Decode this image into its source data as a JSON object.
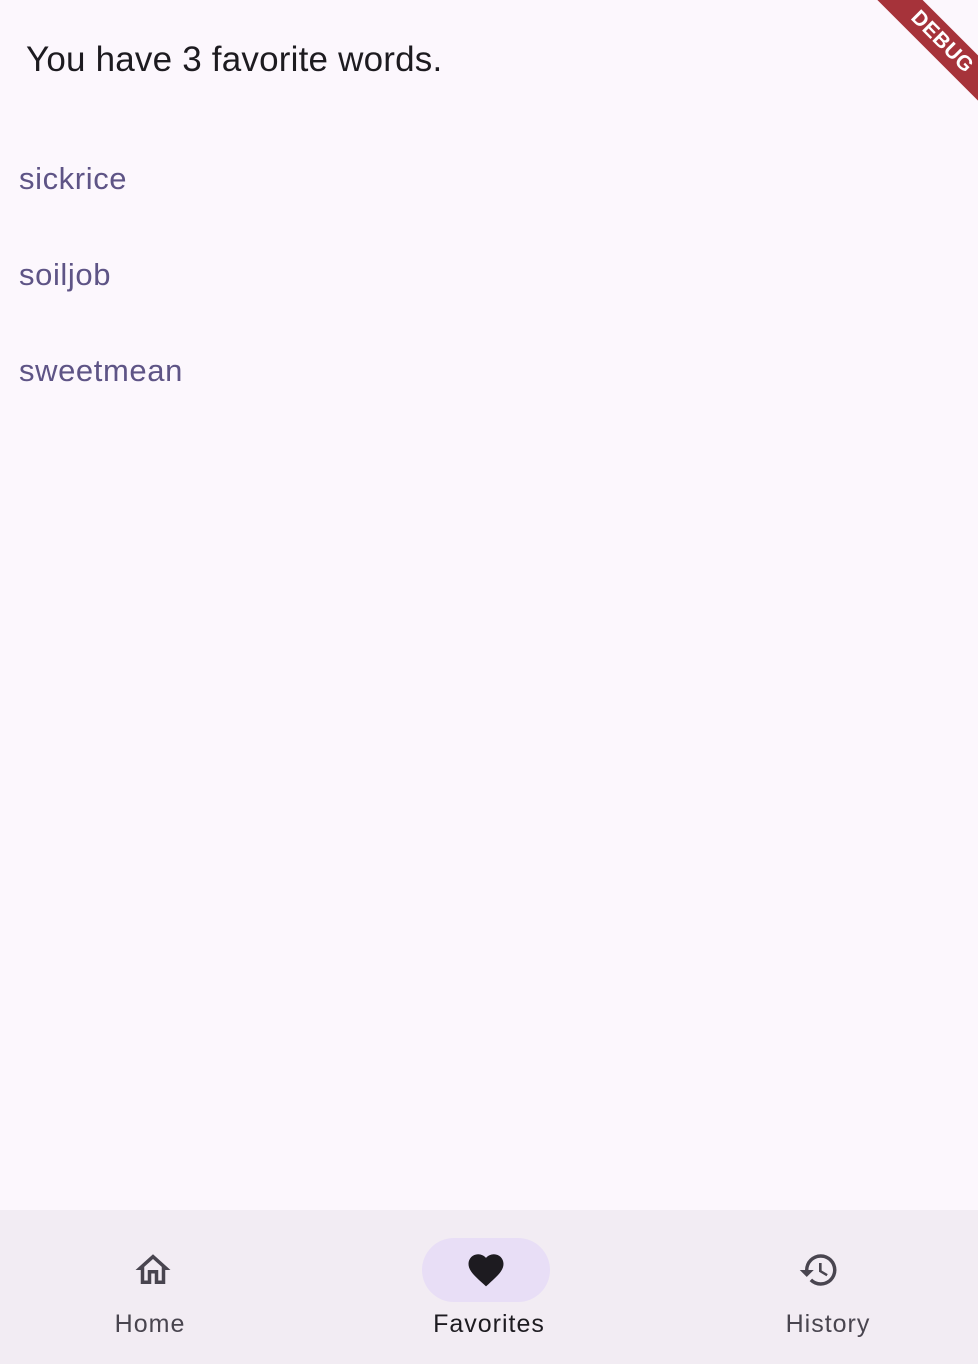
{
  "header": {
    "favorites_count_text": "You have 3 favorite words."
  },
  "favorites": {
    "words": [
      "sickrice",
      "soiljob",
      "sweetmean"
    ]
  },
  "nav": {
    "selected": "favorites",
    "items": [
      {
        "key": "home",
        "label": "Home",
        "icon": "home-icon"
      },
      {
        "key": "favorites",
        "label": "Favorites",
        "icon": "heart-icon"
      },
      {
        "key": "history",
        "label": "History",
        "icon": "history-icon"
      }
    ]
  },
  "debug_banner": {
    "label": "DEBUG"
  },
  "colors": {
    "background": "#FCF7FD",
    "nav_background": "#F2ECF3",
    "nav_indicator": "#E8DEF6",
    "word_text": "#5E5486",
    "primary_text": "#1D1B20",
    "debug_banner": "#A6333A"
  }
}
